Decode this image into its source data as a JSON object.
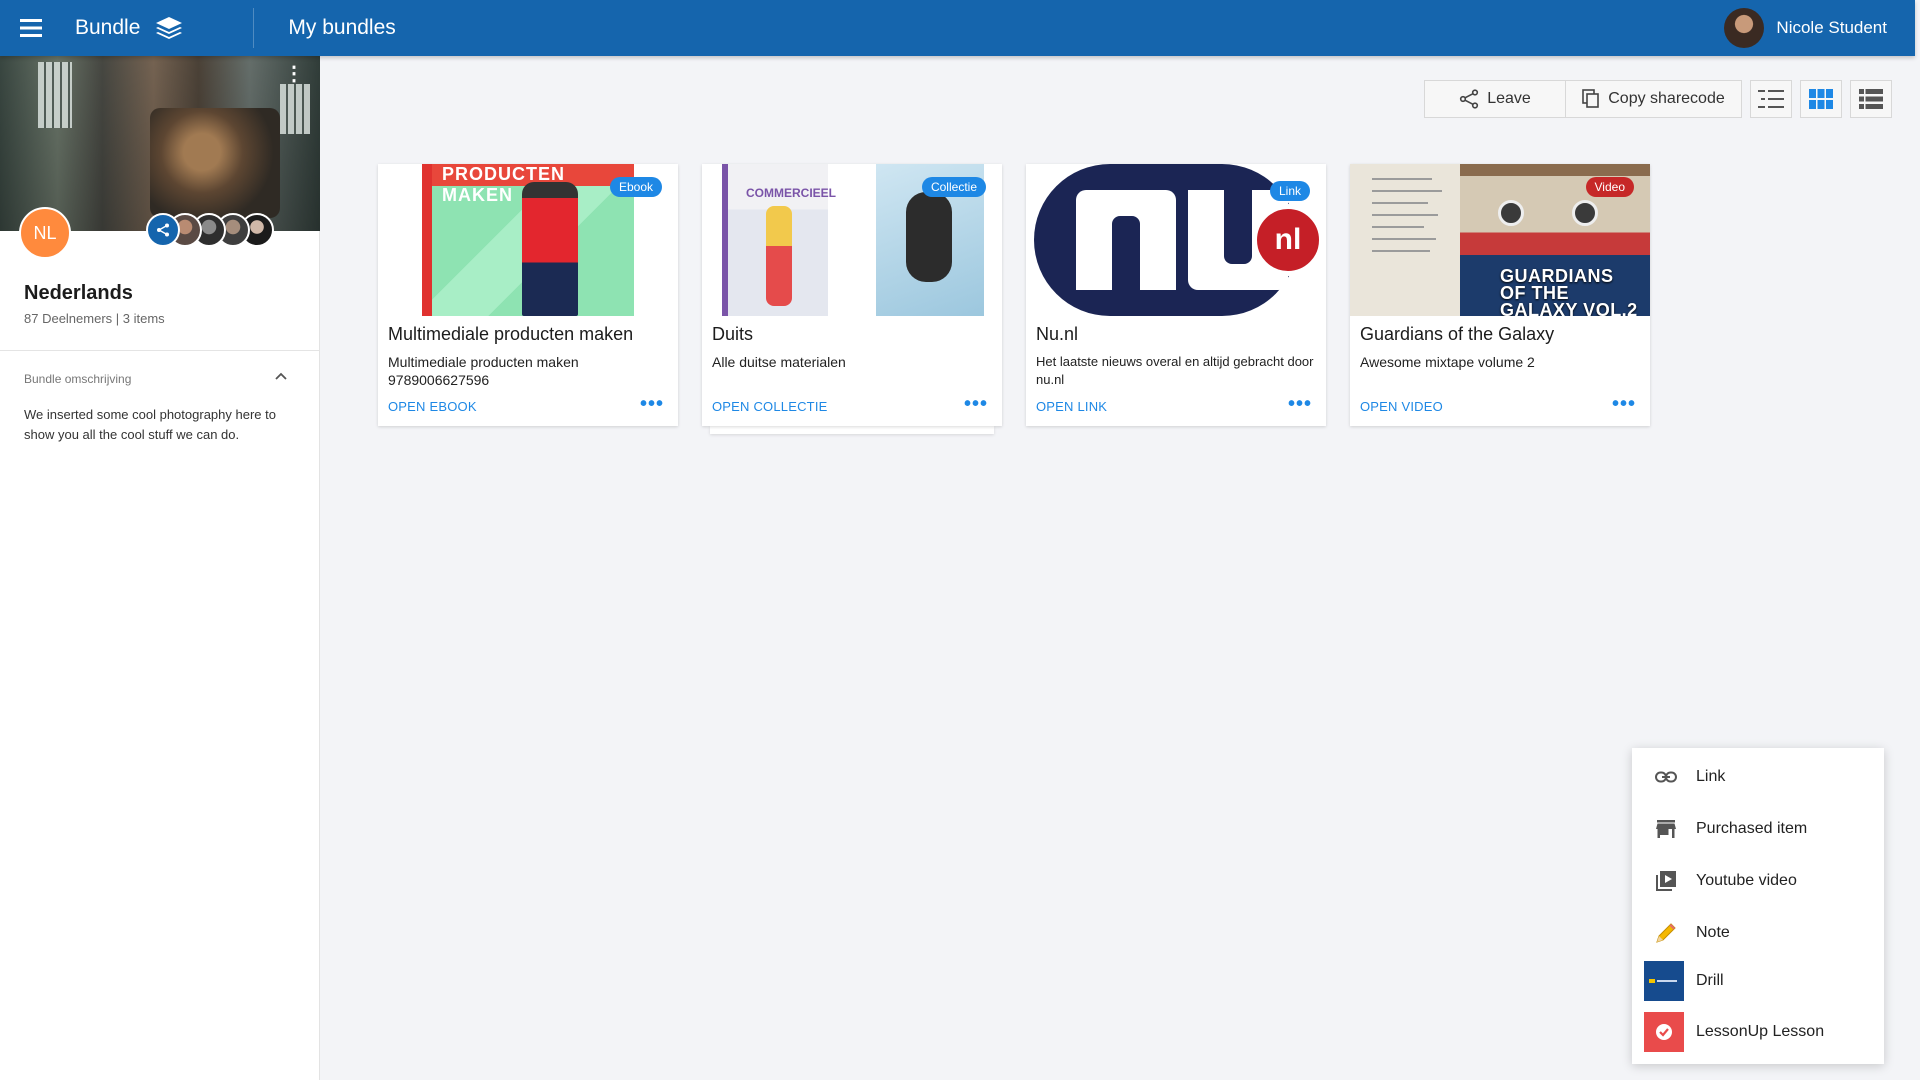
{
  "header": {
    "app_title": "Bundle",
    "page_title": "My bundles",
    "user_name": "Nicole Student"
  },
  "sidebar": {
    "avatar_initials": "NL",
    "bundle_name": "Nederlands",
    "bundle_meta": "87 Deelnemers | 3 items",
    "description_label": "Bundle omschrijving",
    "description": "We inserted some cool photography here to show you all the cool stuff we can do."
  },
  "toolbar": {
    "leave_label": "Leave",
    "copy_label": "Copy sharecode"
  },
  "cards": [
    {
      "badge": "Ebook",
      "badge_color": "#1e88e5",
      "title": "Multimediale producten maken",
      "subtitle": "Multimediale producten maken 9789006627596",
      "action": "OPEN EBOOK",
      "cover_text": "PRODUCTEN MAKEN"
    },
    {
      "badge": "Collectie",
      "badge_color": "#1e88e5",
      "title": "Duits",
      "subtitle": "Alle duitse materialen",
      "action": "OPEN COLLECTIE",
      "cover_text": "COMMERCIEEL"
    },
    {
      "badge": "Link",
      "badge_color": "#1e88e5",
      "title": "Nu.nl",
      "subtitle": "Het laatste nieuws overal en altijd gebracht door nu.nl",
      "action": "OPEN LINK",
      "cover_text": "nl"
    },
    {
      "badge": "Video",
      "badge_color": "#c62828",
      "title": "Guardians of the Galaxy",
      "subtitle": "Awesome mixtape volume 2",
      "action": "OPEN VIDEO",
      "cover_text": "GUARDIANS OF THE GALAXY VOL.2"
    }
  ],
  "add_menu": {
    "items": [
      {
        "label": "Link",
        "icon": "link-icon"
      },
      {
        "label": "Purchased item",
        "icon": "store-icon"
      },
      {
        "label": "Youtube video",
        "icon": "video-library-icon"
      },
      {
        "label": "Note",
        "icon": "pencil-icon"
      },
      {
        "label": "Drill",
        "icon": "drillster-icon"
      },
      {
        "label": "LessonUp Lesson",
        "icon": "lessonup-icon"
      }
    ]
  },
  "colors": {
    "primary": "#1565ad",
    "accent": "#1e88e5",
    "avatar_orange": "#ff8a3d",
    "video_badge": "#c62828",
    "lessonup_red": "#e94b4b",
    "drill_blue": "#164b8e"
  }
}
